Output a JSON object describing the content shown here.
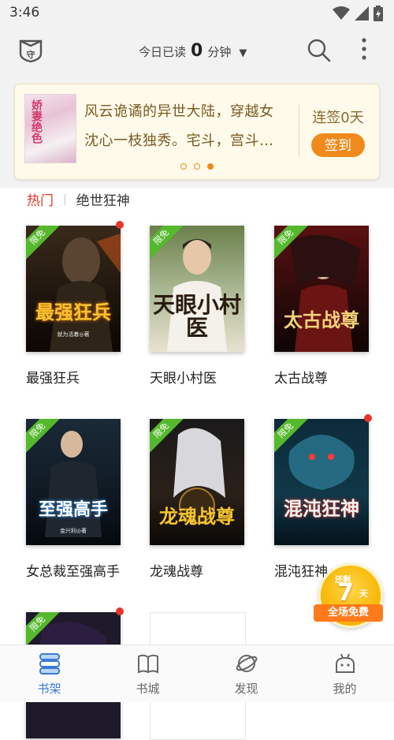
{
  "status_bar": {
    "time": "3:46"
  },
  "header": {
    "read_prefix": "今日已读",
    "read_minutes": "0",
    "read_unit": "分钟"
  },
  "banner": {
    "cover_text": "娇妻绝色",
    "line1": "风云诡谲的异世大陆，穿越女",
    "line2": "沈心一枝独秀。宅斗，宫斗…",
    "sign_status": "连签0天",
    "sign_button": "签到",
    "pages": 3,
    "active_page": 3
  },
  "tags": {
    "hot": "热门",
    "second": "绝世狂神"
  },
  "books": [
    {
      "title": "最强狂兵",
      "cover_title": "最强狂兵",
      "cover_author": "就为活着◎著",
      "badge": "限免",
      "has_dot": true
    },
    {
      "title": "天眼小村医",
      "cover_title": "天眼小村医",
      "cover_author": "",
      "badge": "限免",
      "has_dot": false
    },
    {
      "title": "太古战尊",
      "cover_title": "太古战尊",
      "cover_author": "",
      "badge": "限免",
      "has_dot": false
    },
    {
      "title": "女总裁至强高手",
      "cover_title": "至强高手",
      "cover_author": "金兴利◎著",
      "badge": "限免",
      "has_dot": false
    },
    {
      "title": "龙魂战尊",
      "cover_title": "龙魂战尊",
      "cover_author": "",
      "badge": "限免",
      "has_dot": false
    },
    {
      "title": "混沌狂神",
      "cover_title": "混沌狂神",
      "cover_author": "",
      "badge": "限免",
      "has_dot": true
    },
    {
      "title": "",
      "cover_title": "",
      "cover_author": "",
      "badge": "限免",
      "has_dot": true
    }
  ],
  "promo": {
    "top": "还剩",
    "days": "7",
    "unit": "天",
    "ribbon": "全场免费"
  },
  "tabbar": {
    "items": [
      {
        "label": "书架",
        "icon": "bookshelf-icon",
        "active": true
      },
      {
        "label": "书城",
        "icon": "bookstore-icon",
        "active": false
      },
      {
        "label": "发现",
        "icon": "discover-icon",
        "active": false
      },
      {
        "label": "我的",
        "icon": "profile-icon",
        "active": false
      }
    ]
  },
  "colors": {
    "accent": "#f08a1c",
    "hot": "#e8352a",
    "active_tab": "#3a7bd5",
    "free_badge": "#55b82d"
  }
}
